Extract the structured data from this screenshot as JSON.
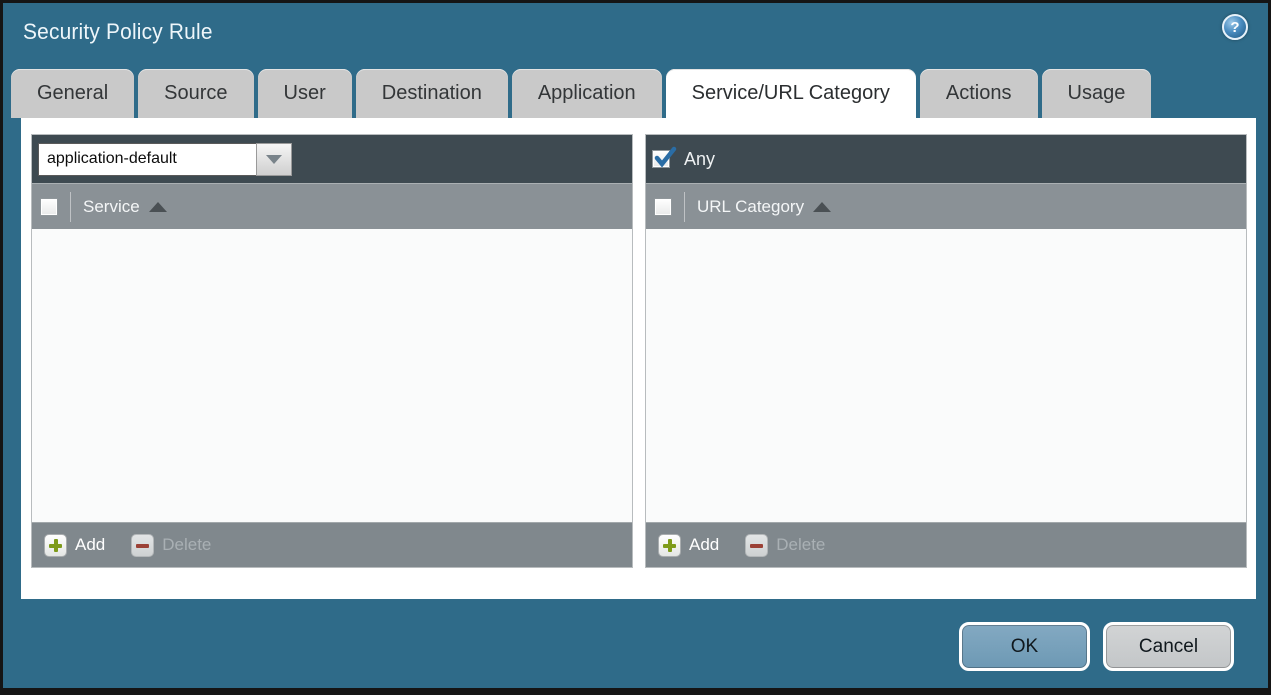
{
  "window": {
    "title": "Security Policy Rule",
    "help_icon": "help-icon",
    "help_glyph": "?"
  },
  "tabs": [
    {
      "label": "General",
      "active": false
    },
    {
      "label": "Source",
      "active": false
    },
    {
      "label": "User",
      "active": false
    },
    {
      "label": "Destination",
      "active": false
    },
    {
      "label": "Application",
      "active": false
    },
    {
      "label": "Service/URL Category",
      "active": true
    },
    {
      "label": "Actions",
      "active": false
    },
    {
      "label": "Usage",
      "active": false
    }
  ],
  "service_panel": {
    "dropdown_value": "application-default",
    "dropdown_icon": "chevron-down-icon",
    "select_all_checked": false,
    "column_header": "Service",
    "sort_icon": "sort-ascending-icon",
    "rows": [],
    "add_label": "Add",
    "delete_label": "Delete",
    "delete_enabled": false
  },
  "url_category_panel": {
    "any_label": "Any",
    "any_checked": true,
    "select_all_checked": false,
    "column_header": "URL Category",
    "sort_icon": "sort-ascending-icon",
    "rows": [],
    "add_label": "Add",
    "delete_label": "Delete",
    "delete_enabled": false
  },
  "dialog_buttons": {
    "ok": "OK",
    "cancel": "Cancel"
  },
  "colors": {
    "dialog_background": "#2F6B89",
    "panel_toolbar": "#3E4A51",
    "panel_header": "#8A9196",
    "panel_footer": "#80888D",
    "tab_inactive": "#C9C9C9",
    "tab_active": "#FFFFFF",
    "ok_button": "#6F9EBB",
    "cancel_button": "#C9CCCE",
    "add_icon_green": "#7E9B1B",
    "delete_icon_red": "#9B4136",
    "checkmark_blue": "#2A6DA5"
  }
}
